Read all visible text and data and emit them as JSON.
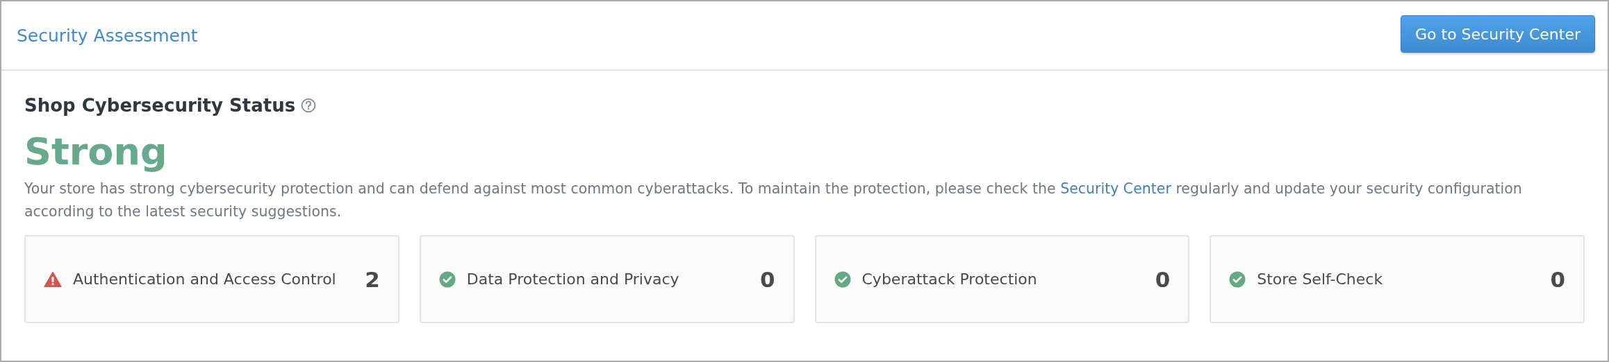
{
  "header": {
    "title": "Security Assessment",
    "button": "Go to Security Center"
  },
  "status": {
    "heading": "Shop Cybersecurity Status",
    "level_text": "Strong",
    "description": {
      "before": "Your store has strong cybersecurity protection and can defend against most common cyberattacks. To maintain the protection, please check the",
      "link": "Security Center",
      "after": "regularly and update your security configuration according to the latest security suggestions."
    }
  },
  "categories": [
    {
      "label": "Authentication and Access Control",
      "count": "2",
      "kind": "warning"
    },
    {
      "label": "Data Protection and Privacy",
      "count": "0",
      "kind": "ok"
    },
    {
      "label": "Cyberattack Protection",
      "count": "0",
      "kind": "ok"
    },
    {
      "label": "Store Self-Check",
      "count": "0",
      "kind": "ok"
    }
  ]
}
